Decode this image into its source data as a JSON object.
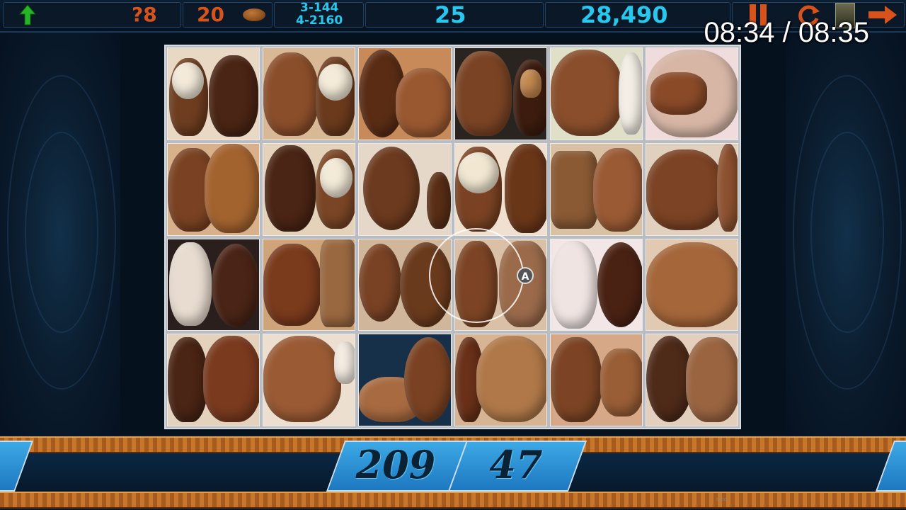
{
  "hud": {
    "hint_count": "?8",
    "coins": "20",
    "level_line1": "3-144",
    "level_line2": "4-2160",
    "moves": "25",
    "score": "28,490"
  },
  "timer": "08:34 / 08:35",
  "cursor_label": "A",
  "bottom": {
    "left_count": "209",
    "right_count": "47"
  },
  "colors": {
    "hud_orange": "#d8531c",
    "hud_cyan": "#27c8ee",
    "panel_blue": "#3da9e6",
    "rail_copper": "#c7772c"
  },
  "icons": [
    "up-arrow-icon",
    "coin-icon",
    "pause-icon",
    "restart-icon",
    "lantern-icon",
    "next-arrow-icon"
  ]
}
